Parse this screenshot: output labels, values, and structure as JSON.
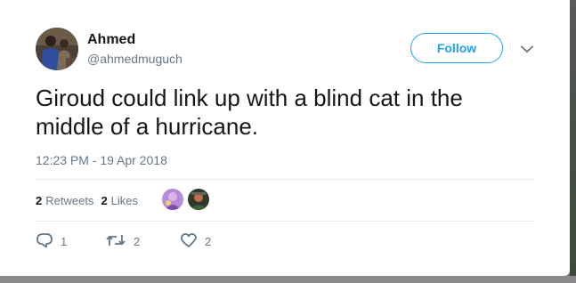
{
  "user": {
    "name": "Ahmed",
    "handle": "@ahmedmuguch",
    "follow_label": "Follow"
  },
  "tweet": {
    "text": "Giroud could link up with a blind cat in the middle of a hurricane.",
    "timestamp": "12:23 PM - 19 Apr 2018"
  },
  "stats": {
    "retweets_count": "2",
    "retweets_label": "Retweets",
    "likes_count": "2",
    "likes_label": "Likes"
  },
  "actions": {
    "reply_count": "1",
    "retweet_count": "2",
    "like_count": "2"
  },
  "colors": {
    "accent": "#1da1f2",
    "text": "#14171a",
    "secondary": "#657786"
  },
  "icons": [
    "chevron-down-icon",
    "reply-icon",
    "retweet-icon",
    "heart-icon"
  ]
}
